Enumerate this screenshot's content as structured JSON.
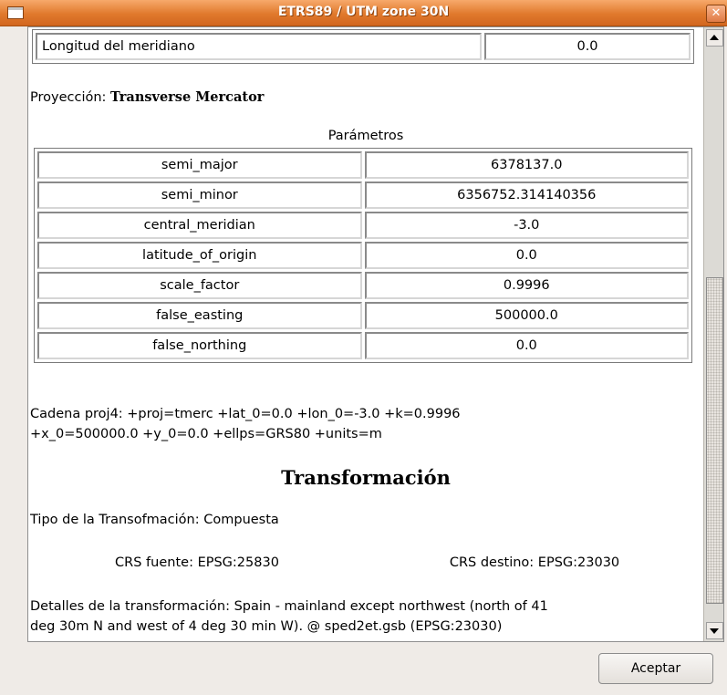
{
  "window": {
    "title": "ETRS89 / UTM zone 30N"
  },
  "meridian_table": {
    "label": "Longitud del meridiano",
    "value": "0.0"
  },
  "projection": {
    "label": "Proyección:",
    "name": "Transverse Mercator"
  },
  "parameters": {
    "caption": "Parámetros",
    "rows": [
      {
        "name": "semi_major",
        "value": "6378137.0"
      },
      {
        "name": "semi_minor",
        "value": "6356752.314140356"
      },
      {
        "name": "central_meridian",
        "value": "-3.0"
      },
      {
        "name": "latitude_of_origin",
        "value": "0.0"
      },
      {
        "name": "scale_factor",
        "value": "0.9996"
      },
      {
        "name": "false_easting",
        "value": "500000.0"
      },
      {
        "name": "false_northing",
        "value": "0.0"
      }
    ]
  },
  "proj4": {
    "line1": "Cadena proj4: +proj=tmerc +lat_0=0.0 +lon_0=-3.0 +k=0.9996",
    "line2": "+x_0=500000.0 +y_0=0.0 +ellps=GRS80 +units=m"
  },
  "transformation": {
    "heading": "Transformación",
    "type": "Tipo de la Transofmación: Compuesta",
    "source_crs": "CRS fuente: EPSG:25830",
    "target_crs": "CRS destino: EPSG:23030",
    "details_line1": "Detalles de la transformación: Spain - mainland except northwest (north of 41",
    "details_line2": "deg 30m N and west of 4 deg 30 min W). @ sped2et.gsb (EPSG:23030)"
  },
  "buttons": {
    "accept": "Aceptar"
  }
}
